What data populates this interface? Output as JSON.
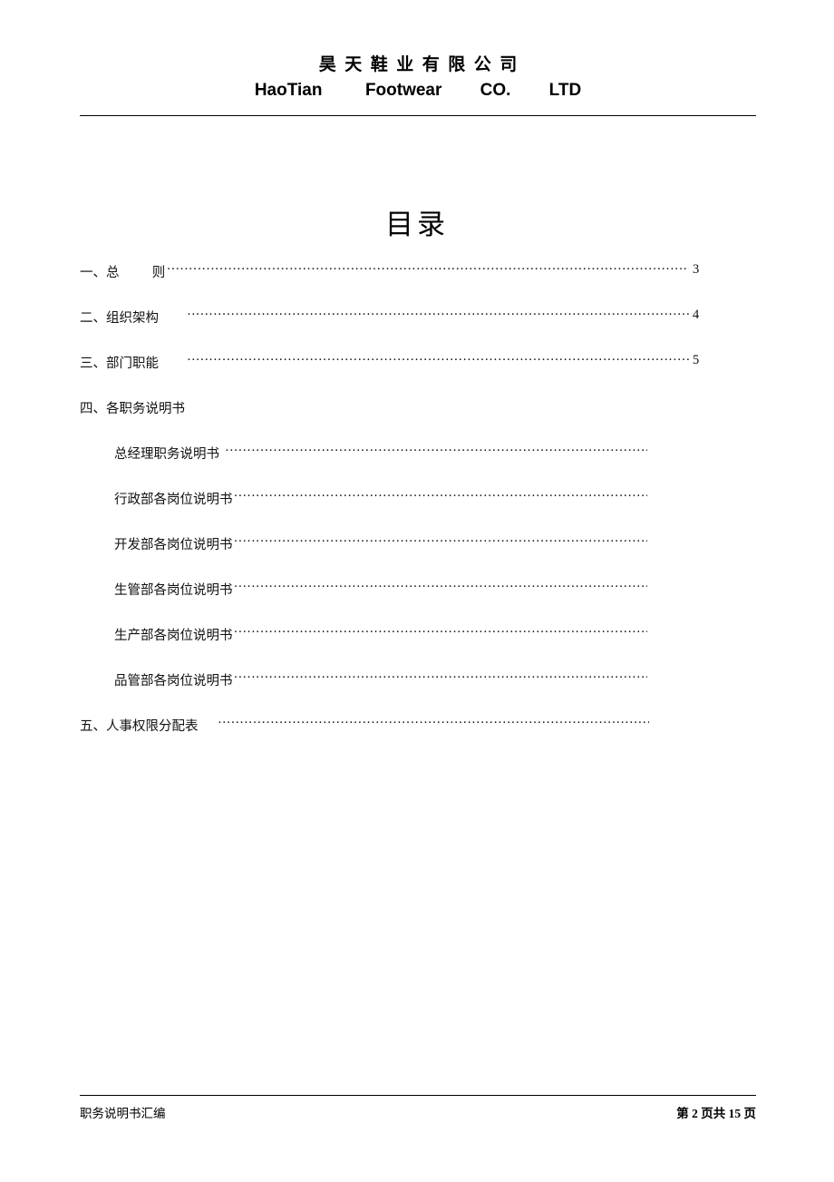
{
  "header": {
    "company_cn": "昊  天  鞋  业  有  限  公  司",
    "company_en": "HaoTian         Footwear        CO.        LTD"
  },
  "title": "目录",
  "toc": {
    "entries": [
      {
        "label": "一、总          则",
        "page": "3",
        "indent": false,
        "dots": "w1"
      },
      {
        "label": "二、组织架构",
        "page": "4",
        "indent": false,
        "dots": "w2"
      },
      {
        "label": "三、部门职能",
        "page": "5",
        "indent": false,
        "dots": "w3"
      },
      {
        "label": "四、各职务说明书",
        "page": "",
        "indent": false,
        "dots": "none"
      },
      {
        "label": "总经理职务说明书",
        "page": "",
        "indent": true,
        "dots": "sub"
      },
      {
        "label": "行政部各岗位说明书",
        "page": "",
        "indent": true,
        "dots": "sub"
      },
      {
        "label": "开发部各岗位说明书",
        "page": "",
        "indent": true,
        "dots": "sub"
      },
      {
        "label": "生管部各岗位说明书",
        "page": "",
        "indent": true,
        "dots": "sub"
      },
      {
        "label": "生产部各岗位说明书",
        "page": "",
        "indent": true,
        "dots": "sub"
      },
      {
        "label": "品管部各岗位说明书",
        "page": "",
        "indent": true,
        "dots": "sub"
      },
      {
        "label": "五、人事权限分配表",
        "page": "",
        "indent": false,
        "dots": "last"
      }
    ],
    "dot_char": "·"
  },
  "footer": {
    "left": "职务说明书汇编",
    "right": "第 2 页共 15 页"
  }
}
